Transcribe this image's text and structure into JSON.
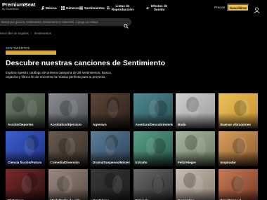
{
  "header": {
    "logo_title": "PremiumBeat",
    "logo_sub": "By Shutterstock",
    "nav": [
      {
        "label": "Música"
      },
      {
        "label": "Géneros"
      },
      {
        "label": "Sentimientos"
      },
      {
        "label_line1": "Listas de",
        "label_line2": "Reproducción"
      },
      {
        "label_line1": "Efectos de",
        "label_line2": "Sonido"
      }
    ],
    "pricing": "Precios",
    "subscribe": "Suscribirse"
  },
  "search": {
    "placeholder": "Busca por género, sentimiento, instrumento o colección, o pega un enlace"
  },
  "breadcrumb": {
    "parent": "Inicio libre de regalías",
    "current": "Sentimientos"
  },
  "hero": {
    "eyebrow": "SENTIMIENTOS",
    "title": "Descubre nuestras canciones de Sentimiento",
    "description": "Explora nuestro catálogo de primera categoría de 28 sentimientos. Busca, organiza y filtra a fin de encontrar la música perfecta para tu proyecto."
  },
  "tiles": [
    {
      "label": "Acción/Deportes",
      "colors": [
        "#6c7a6a",
        "#3d4a3a"
      ]
    },
    {
      "label": "Acrobático/Ejercicio",
      "colors": [
        "#8a8d92",
        "#4c4f55"
      ]
    },
    {
      "label": "Agresivo",
      "colors": [
        "#5e4638",
        "#2a201a"
      ]
    },
    {
      "label": "Aventura/Descubrimiento",
      "colors": [
        "#4f8a90",
        "#2a5058"
      ]
    },
    {
      "label": "Boda",
      "colors": [
        "#cfcfcf",
        "#9a9a9a"
      ]
    },
    {
      "label": "Buenas vibraciones",
      "colors": [
        "#e8c25a",
        "#c98f2e"
      ]
    },
    {
      "label": "Ciencia ficción/Futuro",
      "colors": [
        "#3c5fd0",
        "#1e2e80"
      ]
    },
    {
      "label": "Comedia/Diversión",
      "colors": [
        "#6a5a4e",
        "#3a2f28"
      ]
    },
    {
      "label": "Drama/Suspenso/Misterio",
      "colors": [
        "#5a7e9a",
        "#2c4258"
      ]
    },
    {
      "label": "Extraño",
      "colors": [
        "#58a08a",
        "#2a5a4c"
      ]
    },
    {
      "label": "Feliz/Alegre",
      "colors": [
        "#a9b6a0",
        "#6a7a60"
      ]
    },
    {
      "label": "Inspirador",
      "colors": [
        "#d9a060",
        "#8a5a28"
      ]
    },
    {
      "label": "Misterioso",
      "colors": [
        "#7a2a2a",
        "#2a0e0e"
      ]
    },
    {
      "label": "Moda/Estilo de vida",
      "colors": [
        "#9a8a80",
        "#5a4a42"
      ]
    },
    {
      "label": "Nostálgico",
      "colors": [
        "#3a3a3a",
        "#1a1a1a"
      ]
    },
    {
      "label": "Relajado",
      "colors": [
        "#6a6a6a",
        "#2a2a2a"
      ]
    },
    {
      "label": "Romántico",
      "colors": [
        "#c8bcb0",
        "#8a7e72"
      ]
    },
    {
      "label": "Sexy/Sensual",
      "colors": [
        "#c87a56",
        "#7a3a22"
      ]
    }
  ],
  "colors": {
    "accent": "#f0c044",
    "gold_bar": "#d9a93f",
    "background": "#000000"
  }
}
